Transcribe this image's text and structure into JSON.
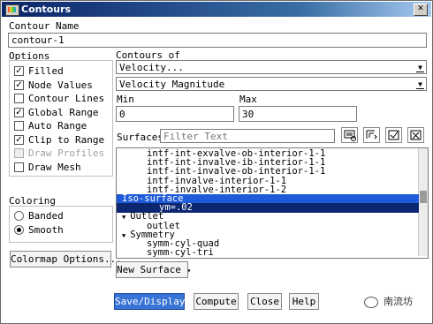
{
  "window": {
    "title": "Contours",
    "close_glyph": "✕"
  },
  "contour_name": {
    "label": "Contour Name",
    "value": "contour-1"
  },
  "options": {
    "label": "Options",
    "items": [
      {
        "label": "Filled",
        "checked": true,
        "disabled": false
      },
      {
        "label": "Node Values",
        "checked": true,
        "disabled": false
      },
      {
        "label": "Contour Lines",
        "checked": false,
        "disabled": false
      },
      {
        "label": "Global Range",
        "checked": true,
        "disabled": false
      },
      {
        "label": "Auto Range",
        "checked": false,
        "disabled": false
      },
      {
        "label": "Clip to Range",
        "checked": true,
        "disabled": false
      },
      {
        "label": "Draw Profiles",
        "checked": false,
        "disabled": true
      },
      {
        "label": "Draw Mesh",
        "checked": false,
        "disabled": false
      }
    ]
  },
  "coloring": {
    "label": "Coloring",
    "items": [
      {
        "label": "Banded",
        "selected": false
      },
      {
        "label": "Smooth",
        "selected": true
      }
    ]
  },
  "colormap_button": "Colormap Options...",
  "contours_of": {
    "label": "Contours of",
    "category": "Velocity...",
    "quantity": "Velocity Magnitude",
    "arrow": "▼"
  },
  "range": {
    "min_label": "Min",
    "min_value": "0",
    "max_label": "Max",
    "max_value": "30"
  },
  "surfaces": {
    "label": "Surfaces",
    "filter_placeholder": "Filter Text",
    "list": [
      {
        "text": "intf-int-exvalve-ob-interior-1-1",
        "state": ""
      },
      {
        "text": "intf-int-invalve-ib-interior-1-1",
        "state": ""
      },
      {
        "text": "intf-int-invalve-ob-interior-1-1",
        "state": ""
      },
      {
        "text": "intf-invalve-interior-1-1",
        "state": ""
      },
      {
        "text": "intf-invalve-interior-1-2",
        "state": ""
      },
      {
        "text": "Iso-surface",
        "state": "group-selected"
      },
      {
        "text": "ym=.02",
        "state": "selected"
      },
      {
        "text": "Outlet",
        "state": "group"
      },
      {
        "text": "outlet",
        "state": ""
      },
      {
        "text": "Symmetry",
        "state": "group"
      },
      {
        "text": "symm-cyl-quad",
        "state": ""
      },
      {
        "text": "symm-cyl-tri",
        "state": ""
      }
    ]
  },
  "new_surface_button": "New Surface",
  "new_surface_arrow": "▾",
  "tree_arrow": "▼",
  "check_glyph": "✓",
  "actions": {
    "save_display": "Save/Display",
    "compute": "Compute",
    "close": "Close",
    "help": "Help"
  },
  "watermark": "南流坊"
}
